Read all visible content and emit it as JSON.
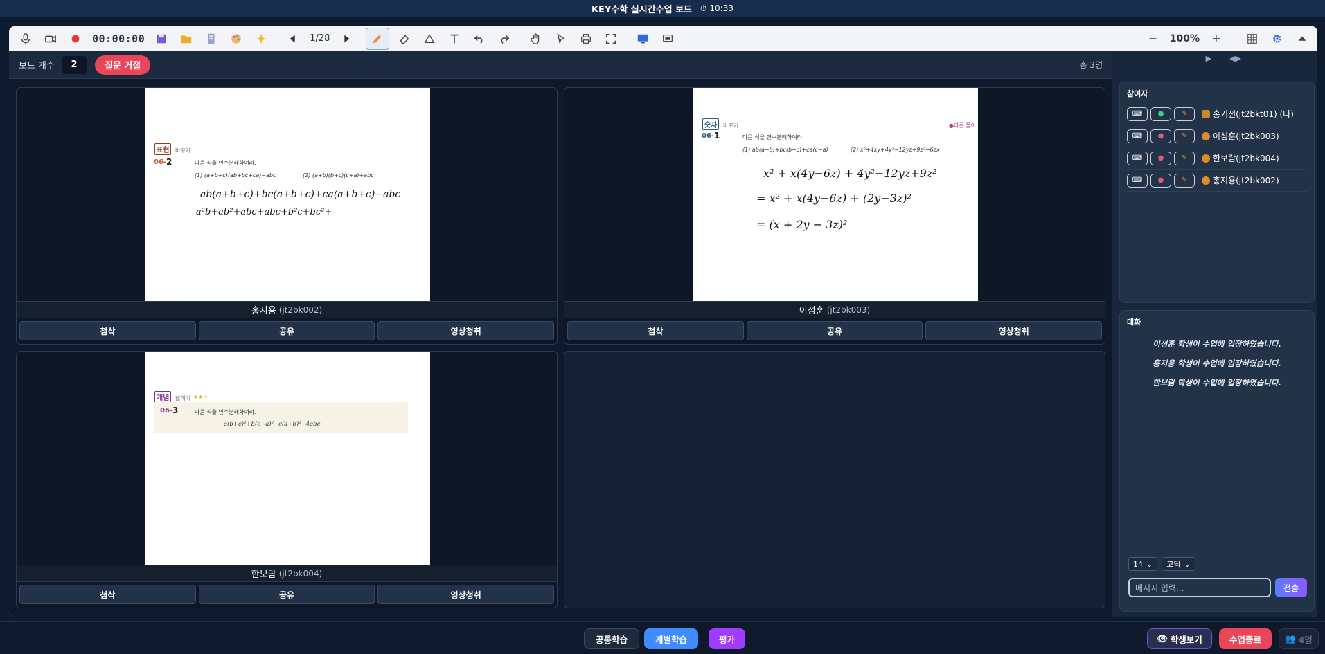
{
  "window": {
    "title": "KEY수학 실시간수업 보드",
    "clock": "10:33"
  },
  "toolbar": {
    "timer": "00:00:00",
    "page": "1/28",
    "zoom": "100%"
  },
  "header": {
    "board_count_label": "보드 개수",
    "board_count": "2",
    "reject_label": "질문 거절",
    "total": "총 3명"
  },
  "boards": [
    {
      "name": "홍지용",
      "id": "(jt2bk002)",
      "tag": "표현",
      "tag_sub": "바꾸기",
      "num_pre": "06-",
      "num": "2",
      "prompt": "다음 식을 인수분해하여라.",
      "problem1": "(1) (a+b+c)(ab+bc+ca)−abc",
      "problem2": "(2) (a+b)(b+c)(c+a)+abc",
      "hw1": "ab(a+b+c)+bc(a+b+c)+ca(a+b+c)−abc",
      "hw2": "a²b+ab²+abc+abc+b²c+bc²+"
    },
    {
      "name": "이성훈",
      "id": "(jt2bk003)",
      "tag": "숫자",
      "tag_sub": "바꾸기",
      "num_pre": "06-",
      "num": "1",
      "note": "●다른 풀이",
      "prompt": "다음 식을 인수분해하여라.",
      "problem1": "(1) ab(a−b)+bc(b−c)+ca(c−a)",
      "problem2": "(2) x²+4xy+4y²−12yz+9z²−6zx",
      "hw1": "x² + x(4y−6z) + 4y²−12yz+9z²",
      "hw2": "= x² + x(4y−6z) + (2y−3z)²",
      "hw3": "= (x + 2y − 3z)²"
    },
    {
      "name": "한보람",
      "id": "(jt2bk004)",
      "tag": "개념",
      "tag_sub": "넓히기",
      "stars": "★★☆",
      "num_pre": "06-",
      "num": "3",
      "prompt": "다음 식을 인수분해하여라.",
      "formula": "a(b+c)²+b(c+a)²+c(a+b)²−4abc"
    }
  ],
  "board_buttons": [
    "첨삭",
    "공유",
    "영상청취"
  ],
  "participants": {
    "title": "참여자",
    "list": [
      {
        "name": "홍기선(jt2bkt01) (나)"
      },
      {
        "name": "이성훈(jt2bk003)"
      },
      {
        "name": "한보람(jt2bk004)"
      },
      {
        "name": "홍지용(jt2bk002)"
      }
    ]
  },
  "chat": {
    "title": "대화",
    "messages": [
      "이성훈 학생이 수업에 입장하였습니다.",
      "홍지용 학생이 수업에 입장하였습니다.",
      "한보람 학생이 수업에 입장하였습니다."
    ],
    "font_size": "14",
    "font_name": "고딕",
    "placeholder": "메시지 입력...",
    "send": "전송"
  },
  "bottom": {
    "common": "공통학습",
    "individual": "개별학습",
    "eval": "평가",
    "view_students": "학생보기",
    "end_class": "수업종료",
    "count": "4명"
  },
  "colors": {
    "accent_blue": "#3f8cff",
    "accent_purple": "#a03cff",
    "danger": "#e9465a"
  }
}
